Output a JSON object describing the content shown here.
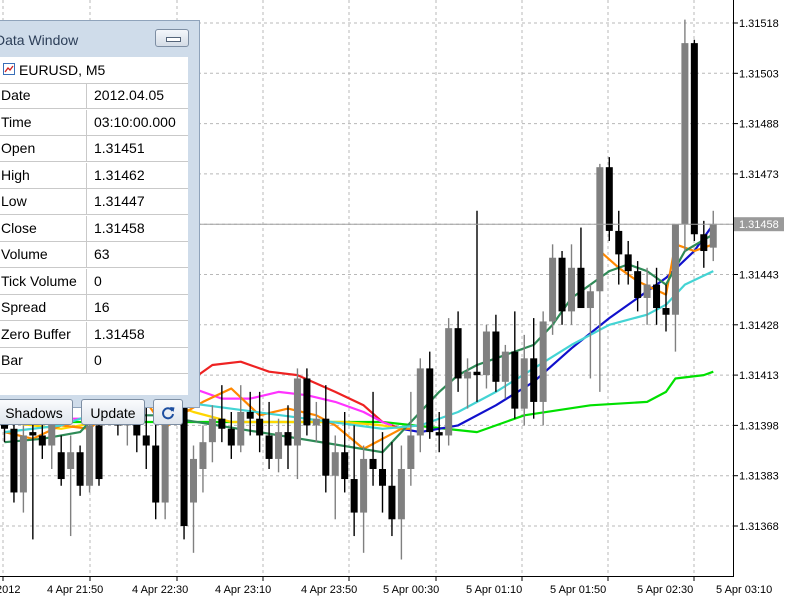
{
  "data_window": {
    "title": "Data Window",
    "symbol": "EURUSD, M5",
    "rows": [
      {
        "label": "Date",
        "value": "2012.04.05"
      },
      {
        "label": "Time",
        "value": "03:10:00.000"
      },
      {
        "label": "Open",
        "value": "1.31451"
      },
      {
        "label": "High",
        "value": "1.31462"
      },
      {
        "label": "Low",
        "value": "1.31447"
      },
      {
        "label": "Close",
        "value": "1.31458"
      },
      {
        "label": "Volume",
        "value": "63"
      },
      {
        "label": "Tick Volume",
        "value": "0"
      },
      {
        "label": "Spread",
        "value": "16"
      },
      {
        "label": "Zero Buffer",
        "value": "1.31458"
      },
      {
        "label": "Bar",
        "value": "0"
      }
    ],
    "buttons": {
      "shadows": "Shadows",
      "update": "Update",
      "refresh_icon": "refresh-icon"
    }
  },
  "chart_data": {
    "type": "candlestick",
    "symbol": "EURUSD, M5",
    "current_price": "1.31458",
    "y_ticks": [
      1.31368,
      1.31383,
      1.31398,
      1.31413,
      1.31428,
      1.31443,
      1.31458,
      1.31473,
      1.31488,
      1.31503,
      1.31518
    ],
    "y_tick_labels": [
      "1.31368",
      "1.31383",
      "1.31398",
      "1.31413",
      "1.31428",
      "1.31443",
      "1.31473",
      "1.31488",
      "1.31503",
      "1.31518"
    ],
    "x_tick_labels": [
      "2012",
      "4 Apr 21:50",
      "4 Apr 22:30",
      "4 Apr 23:10",
      "4 Apr 23:50",
      "5 Apr 00:30",
      "5 Apr 01:10",
      "5 Apr 01:50",
      "5 Apr 02:30",
      "5 Apr 03:10"
    ],
    "grid": true,
    "candles": [
      [
        1.31402,
        1.31405,
        1.31393,
        1.31397
      ],
      [
        1.31397,
        1.314,
        1.31375,
        1.31378
      ],
      [
        1.31378,
        1.31398,
        1.31372,
        1.31395
      ],
      [
        1.31396,
        1.31401,
        1.31364,
        1.31395
      ],
      [
        1.31395,
        1.31408,
        1.31388,
        1.31392
      ],
      [
        1.31392,
        1.31403,
        1.31385,
        1.314
      ],
      [
        1.3139,
        1.31395,
        1.3138,
        1.31382
      ],
      [
        1.31385,
        1.31395,
        1.31365,
        1.3139
      ],
      [
        1.3139,
        1.31392,
        1.31377,
        1.3138
      ],
      [
        1.3138,
        1.31401,
        1.31378,
        1.31398
      ],
      [
        1.31398,
        1.31402,
        1.3138,
        1.31382
      ],
      [
        1.31405,
        1.31412,
        1.314,
        1.31407
      ],
      [
        1.31407,
        1.31415,
        1.31395,
        1.31398
      ],
      [
        1.31398,
        1.31405,
        1.31392,
        1.31402
      ],
      [
        1.31402,
        1.31408,
        1.3139,
        1.31395
      ],
      [
        1.31395,
        1.31412,
        1.31385,
        1.31392
      ],
      [
        1.31392,
        1.3141,
        1.3137,
        1.31375
      ],
      [
        1.31375,
        1.31418,
        1.3137,
        1.31415
      ],
      [
        1.31412,
        1.31416,
        1.314,
        1.31405
      ],
      [
        1.31405,
        1.31415,
        1.31364,
        1.31368
      ],
      [
        1.31375,
        1.31392,
        1.3136,
        1.31388
      ],
      [
        1.31385,
        1.31398,
        1.31378,
        1.31393
      ],
      [
        1.31393,
        1.31404,
        1.31387,
        1.314
      ],
      [
        1.314,
        1.3141,
        1.31393,
        1.31397
      ],
      [
        1.31397,
        1.31402,
        1.31388,
        1.31392
      ],
      [
        1.31392,
        1.3141,
        1.3139,
        1.31402
      ],
      [
        1.31402,
        1.31408,
        1.31395,
        1.314
      ],
      [
        1.314,
        1.31408,
        1.3139,
        1.31395
      ],
      [
        1.31395,
        1.31405,
        1.31385,
        1.31388
      ],
      [
        1.31388,
        1.314,
        1.31384,
        1.31396
      ],
      [
        1.31396,
        1.31404,
        1.31385,
        1.31392
      ],
      [
        1.31392,
        1.31415,
        1.31382,
        1.31412
      ],
      [
        1.31412,
        1.31415,
        1.31395,
        1.31398
      ],
      [
        1.31398,
        1.31405,
        1.31393,
        1.314
      ],
      [
        1.314,
        1.3141,
        1.31378,
        1.31383
      ],
      [
        1.31383,
        1.31395,
        1.3137,
        1.3139
      ],
      [
        1.3139,
        1.31402,
        1.31378,
        1.31382
      ],
      [
        1.31382,
        1.31398,
        1.31365,
        1.31372
      ],
      [
        1.31372,
        1.31392,
        1.3136,
        1.31388
      ],
      [
        1.31388,
        1.31408,
        1.3138,
        1.31385
      ],
      [
        1.31385,
        1.31396,
        1.31372,
        1.3138
      ],
      [
        1.3138,
        1.31393,
        1.31365,
        1.3137
      ],
      [
        1.3137,
        1.31392,
        1.31358,
        1.31385
      ],
      [
        1.31385,
        1.31408,
        1.3138,
        1.31395
      ],
      [
        1.31395,
        1.31418,
        1.3139,
        1.31415
      ],
      [
        1.31415,
        1.3142,
        1.31394,
        1.31396
      ],
      [
        1.31396,
        1.31402,
        1.3139,
        1.31395
      ],
      [
        1.31395,
        1.3143,
        1.31392,
        1.31427
      ],
      [
        1.31427,
        1.31432,
        1.31408,
        1.31412
      ],
      [
        1.31412,
        1.31418,
        1.31403,
        1.31414
      ],
      [
        1.31414,
        1.31462,
        1.31405,
        1.31413
      ],
      [
        1.31413,
        1.31428,
        1.31409,
        1.31426
      ],
      [
        1.31426,
        1.31431,
        1.31408,
        1.31411
      ],
      [
        1.31411,
        1.31422,
        1.31406,
        1.3142
      ],
      [
        1.3142,
        1.31432,
        1.314,
        1.31403
      ],
      [
        1.31403,
        1.31425,
        1.31398,
        1.31418
      ],
      [
        1.31418,
        1.3143,
        1.314,
        1.31405
      ],
      [
        1.31405,
        1.31432,
        1.31398,
        1.31429
      ],
      [
        1.31429,
        1.31452,
        1.31425,
        1.31448
      ],
      [
        1.31448,
        1.3145,
        1.31428,
        1.31432
      ],
      [
        1.31432,
        1.31452,
        1.31428,
        1.31445
      ],
      [
        1.31445,
        1.31457,
        1.31438,
        1.31433
      ],
      [
        1.31433,
        1.3144,
        1.31412,
        1.31438
      ],
      [
        1.31438,
        1.31476,
        1.31408,
        1.31475
      ],
      [
        1.31475,
        1.31478,
        1.31453,
        1.31456
      ],
      [
        1.31456,
        1.31462,
        1.3144,
        1.31449
      ],
      [
        1.31449,
        1.31453,
        1.3144,
        1.31444
      ],
      [
        1.31444,
        1.31447,
        1.31432,
        1.31436
      ],
      [
        1.31436,
        1.31445,
        1.31428,
        1.3144
      ],
      [
        1.3144,
        1.31445,
        1.31428,
        1.31433
      ],
      [
        1.31433,
        1.3144,
        1.31426,
        1.31431
      ],
      [
        1.31431,
        1.31458,
        1.3142,
        1.31458
      ],
      [
        1.31458,
        1.31519,
        1.3145,
        1.31512
      ],
      [
        1.31512,
        1.31513,
        1.31453,
        1.31455
      ],
      [
        1.31455,
        1.31459,
        1.31445,
        1.3145
      ],
      [
        1.31451,
        1.31462,
        1.31447,
        1.31458
      ]
    ],
    "indicators": [
      {
        "color": "#00e000",
        "values": [
          [
            0,
            1.31399
          ],
          [
            30,
            1.31399
          ],
          [
            40,
            1.31399
          ],
          [
            50,
            1.31396
          ],
          [
            55,
            1.31401
          ],
          [
            62,
            1.31404
          ],
          [
            68,
            1.31405
          ],
          [
            70,
            1.31408
          ],
          [
            71,
            1.31412
          ],
          [
            74,
            1.31413
          ],
          [
            75,
            1.31414
          ]
        ]
      },
      {
        "color": "#ee2222",
        "values": [
          [
            18,
            1.31408
          ],
          [
            22,
            1.31416
          ],
          [
            25,
            1.31417
          ],
          [
            28,
            1.31414
          ],
          [
            31,
            1.31413
          ],
          [
            35,
            1.31408
          ],
          [
            38,
            1.31404
          ],
          [
            40,
            1.31399
          ],
          [
            42,
            1.31397
          ]
        ]
      },
      {
        "color": "#1111cc",
        "values": [
          [
            42,
            1.31397
          ],
          [
            44,
            1.31396
          ],
          [
            48,
            1.31398
          ],
          [
            52,
            1.31404
          ],
          [
            56,
            1.31411
          ],
          [
            60,
            1.31421
          ],
          [
            64,
            1.3143
          ],
          [
            68,
            1.31438
          ],
          [
            70,
            1.31442
          ],
          [
            73,
            1.3145
          ],
          [
            75,
            1.31458
          ]
        ]
      },
      {
        "color": "#ff33ff",
        "values": [
          [
            0,
            1.31403
          ],
          [
            6,
            1.314
          ],
          [
            9,
            1.314
          ],
          [
            12,
            1.31405
          ],
          [
            15,
            1.31409
          ],
          [
            19,
            1.3141
          ],
          [
            23,
            1.31406
          ],
          [
            26,
            1.31406
          ],
          [
            29,
            1.31408
          ],
          [
            32,
            1.31407
          ],
          [
            35,
            1.31405
          ],
          [
            38,
            1.31402
          ],
          [
            40,
            1.31399
          ],
          [
            41,
            1.31398
          ]
        ]
      },
      {
        "color": "#ffd600",
        "values": [
          [
            0,
            1.31399
          ],
          [
            6,
            1.31397
          ],
          [
            12,
            1.314
          ],
          [
            16,
            1.31406
          ],
          [
            20,
            1.31402
          ],
          [
            24,
            1.31399
          ],
          [
            30,
            1.31399
          ],
          [
            36,
            1.31399
          ],
          [
            40,
            1.31398
          ],
          [
            42,
            1.31397
          ]
        ]
      },
      {
        "color": "#ff8800",
        "values": [
          [
            0,
            1.31396
          ],
          [
            3,
            1.31394
          ],
          [
            6,
            1.31398
          ],
          [
            9,
            1.31397
          ],
          [
            11,
            1.31402
          ],
          [
            13,
            1.31406
          ],
          [
            15,
            1.31405
          ],
          [
            17,
            1.31397
          ],
          [
            18,
            1.314
          ],
          [
            21,
            1.31405
          ],
          [
            24,
            1.31409
          ],
          [
            27,
            1.31401
          ],
          [
            30,
            1.31403
          ],
          [
            33,
            1.31401
          ],
          [
            35,
            1.31398
          ],
          [
            38,
            1.31391
          ],
          [
            40,
            1.31394
          ],
          [
            42,
            1.31397
          ],
          [
            43,
            1.31397
          ]
        ]
      },
      {
        "color": "#ff8800",
        "values": [
          [
            63,
            1.3145
          ],
          [
            65,
            1.31445
          ],
          [
            67,
            1.31441
          ],
          [
            70,
            1.31437
          ],
          [
            71,
            1.31452
          ],
          [
            73,
            1.3145
          ],
          [
            75,
            1.31452
          ]
        ]
      },
      {
        "color": "#2e8b57",
        "values": [
          [
            0,
            1.31393
          ],
          [
            4,
            1.31394
          ],
          [
            8,
            1.31396
          ],
          [
            10,
            1.31402
          ],
          [
            13,
            1.31401
          ],
          [
            16,
            1.31401
          ],
          [
            40,
            1.3139
          ],
          [
            42,
            1.31396
          ],
          [
            44,
            1.31402
          ],
          [
            46,
            1.31408
          ],
          [
            48,
            1.31413
          ],
          [
            50,
            1.31416
          ],
          [
            52,
            1.31418
          ],
          [
            54,
            1.3142
          ],
          [
            56,
            1.31422
          ],
          [
            58,
            1.31428
          ],
          [
            60,
            1.31436
          ],
          [
            62,
            1.3144
          ],
          [
            64,
            1.31444
          ],
          [
            66,
            1.31446
          ],
          [
            68,
            1.31444
          ],
          [
            70,
            1.3144
          ],
          [
            72,
            1.3145
          ],
          [
            75,
            1.31455
          ]
        ]
      },
      {
        "color": "#44d4d4",
        "values": [
          [
            0,
            1.31396
          ],
          [
            6,
            1.31398
          ],
          [
            12,
            1.31404
          ],
          [
            16,
            1.31406
          ],
          [
            40,
            1.31397
          ],
          [
            44,
            1.31398
          ],
          [
            48,
            1.31402
          ],
          [
            52,
            1.31408
          ],
          [
            56,
            1.31415
          ],
          [
            60,
            1.31422
          ],
          [
            64,
            1.31428
          ],
          [
            68,
            1.31431
          ],
          [
            70,
            1.31434
          ],
          [
            72,
            1.3144
          ],
          [
            75,
            1.31444
          ]
        ]
      }
    ]
  }
}
